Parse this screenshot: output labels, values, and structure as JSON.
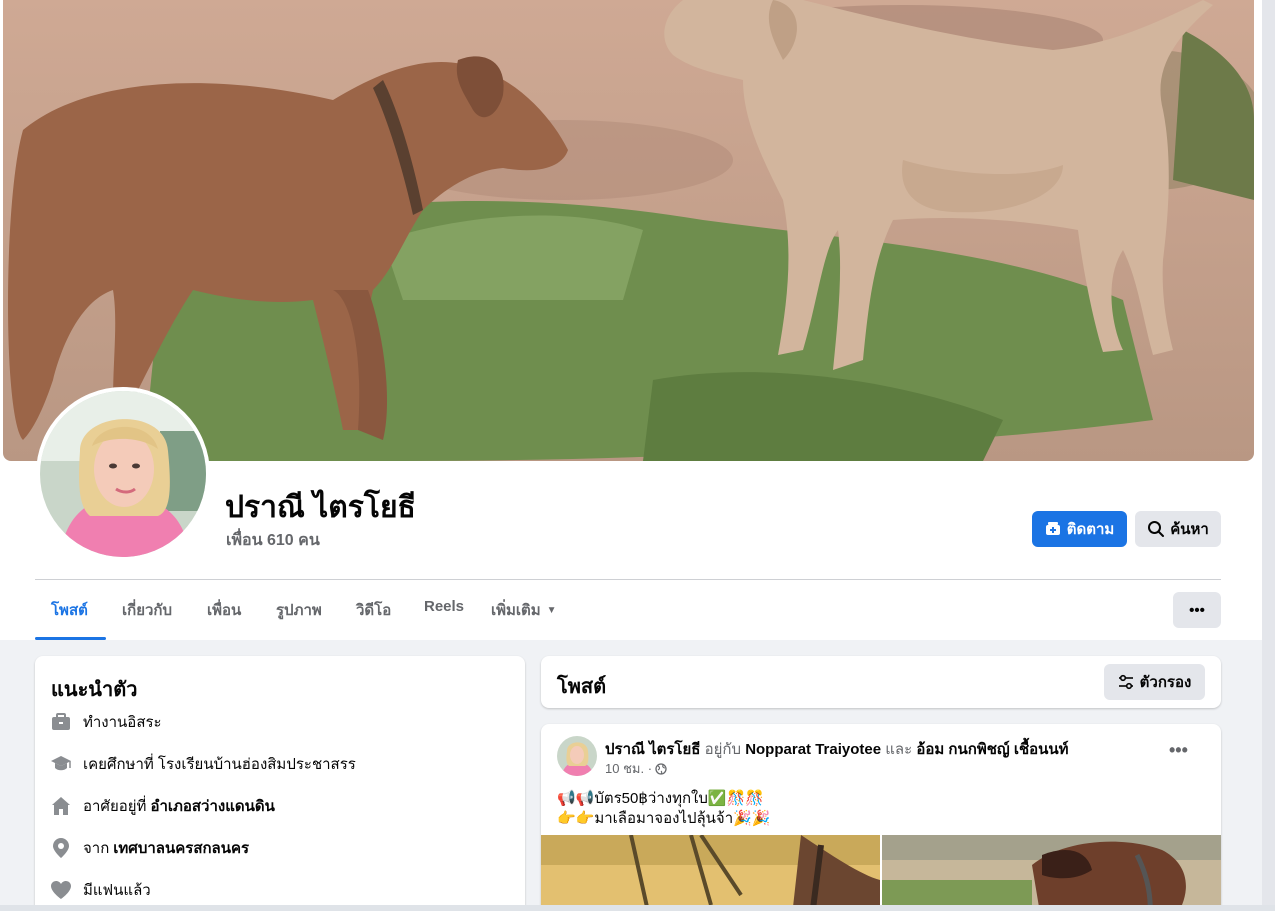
{
  "profile": {
    "name": "ปราณี ไตรโยธี",
    "friends_label": "เพื่อน 610 คน"
  },
  "actions": {
    "follow_label": "ติดตาม",
    "search_label": "ค้นหา",
    "more_label": "•••"
  },
  "tabs": [
    {
      "label": "โพสต์",
      "active": true
    },
    {
      "label": "เกี่ยวกับ",
      "active": false
    },
    {
      "label": "เพื่อน",
      "active": false
    },
    {
      "label": "รูปภาพ",
      "active": false
    },
    {
      "label": "วิดีโอ",
      "active": false
    },
    {
      "label": "Reels",
      "active": false
    },
    {
      "label": "เพิ่มเติม",
      "active": false
    }
  ],
  "intro": {
    "title": "แนะนำตัว",
    "items": [
      {
        "icon": "briefcase-icon",
        "text": "ทำงานอิสระ",
        "bold": ""
      },
      {
        "icon": "graduation-cap-icon",
        "text": "เคยศึกษาที่ โรงเรียนบ้านฮ่องสิมประชาสรร",
        "bold": ""
      },
      {
        "icon": "home-icon",
        "text": "อาศัยอยู่ที่",
        "bold": "อำเภอสว่างแดนดิน"
      },
      {
        "icon": "location-pin-icon",
        "text": "จาก",
        "bold": "เทศบาลนครสกลนคร"
      },
      {
        "icon": "heart-icon",
        "text": "มีแฟนแล้ว",
        "bold": ""
      }
    ]
  },
  "posts_section": {
    "title": "โพสต์",
    "filter_label": "ตัวกรอง"
  },
  "post": {
    "author": "ปราณี ไตรโยธี",
    "with_text": "อยู่กับ",
    "tagged_1": "Nopparat Traiyotee",
    "and_text": "และ",
    "tagged_2": "อ้อม กนกพิชญ์ เชื้อนนท์",
    "time": "10 ชม. ·",
    "menu": "•••",
    "line1": "📢📢บัตร50฿ว่างทุกใบ✅🎊🎊",
    "line2": "👉👉มาเลือมาจองไปลุ้นจ้า🎉🎉"
  },
  "colors": {
    "accent": "#1b74e4",
    "secondary_text": "#65676b",
    "page_bg": "#f0f2f5"
  }
}
